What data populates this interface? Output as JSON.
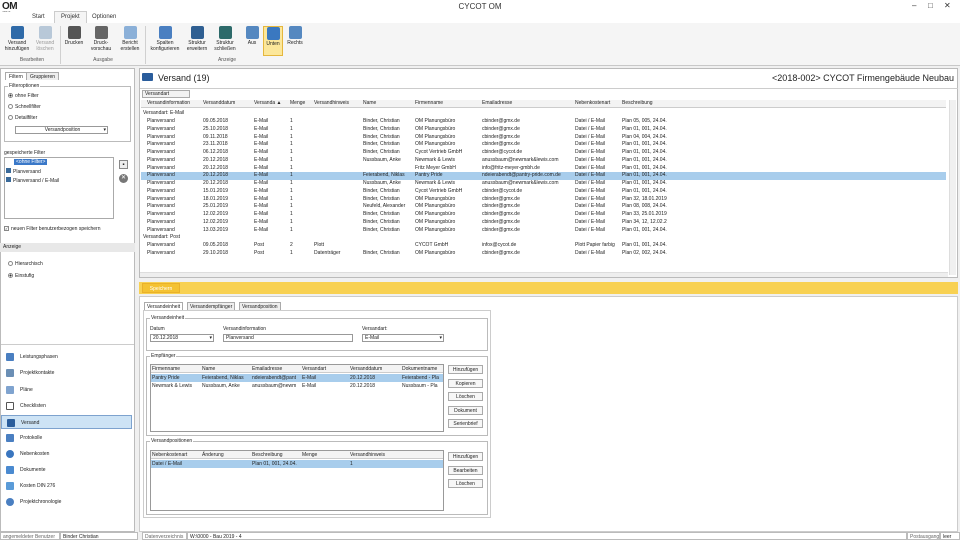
{
  "app": {
    "title": "CYCOT OM",
    "logo": "OM",
    "logo_sub": "gebäude"
  },
  "window_controls": [
    "–",
    "□",
    "✕"
  ],
  "ribbon_tabs": [
    "Start",
    "Projekt",
    "Optionen"
  ],
  "ribbon": {
    "buttons": [
      {
        "label": "Versand hinzufügen",
        "icon": "add-mail-icon",
        "disabled": false
      },
      {
        "label": "Versand löschen",
        "icon": "delete-mail-icon",
        "disabled": true
      },
      {
        "label": "Drucken",
        "icon": "printer-icon",
        "disabled": false
      },
      {
        "label": "Druck-vorschau",
        "icon": "print-preview-icon",
        "disabled": false
      },
      {
        "label": "Bericht erstellen",
        "icon": "report-icon",
        "disabled": false
      },
      {
        "label": "Spalten konfigurieren",
        "icon": "columns-icon",
        "disabled": false
      },
      {
        "label": "Struktur erweitern",
        "icon": "expand-icon",
        "disabled": false
      },
      {
        "label": "Struktur schließen",
        "icon": "collapse-icon",
        "disabled": false
      },
      {
        "label": "Aus",
        "icon": "layout-off-icon",
        "disabled": false
      },
      {
        "label": "Unten",
        "icon": "layout-bottom-icon",
        "disabled": false
      },
      {
        "label": "Rechts",
        "icon": "layout-right-icon",
        "disabled": false
      }
    ],
    "groups": [
      "Bearbeiten",
      "Ausgabe",
      "Anzeige"
    ]
  },
  "left": {
    "tabs": [
      "Filtern",
      "Gruppieren"
    ],
    "filter_options_title": "Filteroptionen",
    "filter_options": [
      "ohne Filter",
      "Schnellfilter",
      "Detailfilter"
    ],
    "filter_field": "Versandposition",
    "saved_filters_title": "gespeicherte Filter",
    "saved_filters": [
      "<ohne Filter>",
      "Planversand",
      "Planversand / E-Mail"
    ],
    "save_user_checkbox": "neuen Filter benutzerbezogen speichern",
    "display_title": "Anzeige",
    "display_options": [
      "Hierarchisch",
      "Einstufig"
    ],
    "nav": [
      "Leistungsphasen",
      "Projektkontakte",
      "Pläne",
      "Checklisten",
      "Versand",
      "Protokolle",
      "Nebenkosten",
      "Dokumente",
      "Kosten DIN 276",
      "Projektchronologie"
    ],
    "nav_active": "Versand",
    "nav_colors": [
      "#4a7fc1",
      "#6b8fb5",
      "#7fa3cf",
      "#777777",
      "#2a5d9c",
      "#4a7fc1",
      "#3a76bf",
      "#4a8ad0",
      "#5a9bd8",
      "#4a7fc1"
    ]
  },
  "main": {
    "title": "Versand (19)",
    "project": "<2018-002> CYCOT Firmengebäude Neubau",
    "group_by": "Versandart",
    "columns": [
      "Versandinformation",
      "Versanddatum",
      "Versanda ▲",
      "Menge",
      "Versandhinweis",
      "Name",
      "Firmenname",
      "Emailadresse",
      "Nebenkostenart",
      "Beschreibung"
    ],
    "group1": "Versandart: E-Mail",
    "rows": [
      [
        "Planversand",
        "09.05.2018",
        "E-Mail",
        "1",
        "",
        "Binder, Christian",
        "OM Planungsbüro",
        "cbinder@gmx.de",
        "Datei / E-Mail",
        "Plan 05, 005, 24.04."
      ],
      [
        "Planversand",
        "25.10.2018",
        "E-Mail",
        "1",
        "",
        "Binder, Christian",
        "OM Planungsbüro",
        "cbinder@gmx.de",
        "Datei / E-Mail",
        "Plan 01, 001, 24.04."
      ],
      [
        "Planversand",
        "09.11.2018",
        "E-Mail",
        "1",
        "",
        "Binder, Christian",
        "OM Planungsbüro",
        "cbinder@gmx.de",
        "Datei / E-Mail",
        "Plan 04, 004, 24.04."
      ],
      [
        "Planversand",
        "23.11.2018",
        "E-Mail",
        "1",
        "",
        "Binder, Christian",
        "OM Planungsbüro",
        "cbinder@gmx.de",
        "Datei / E-Mail",
        "Plan 01, 001, 24.04."
      ],
      [
        "Planversand",
        "06.12.2018",
        "E-Mail",
        "1",
        "",
        "Binder, Christian",
        "Cycot Vertrieb GmbH",
        "cbinder@cycot.de",
        "Datei / E-Mail",
        "Plan 01, 001, 24.04."
      ],
      [
        "Planversand",
        "20.12.2018",
        "E-Mail",
        "1",
        "",
        "Nussbaum, Anke",
        "Newmark & Lewis",
        "anussbaum@newmark&lewis.com",
        "Datei / E-Mail",
        "Plan 01, 001, 24.04."
      ],
      [
        "Planversand",
        "20.12.2018",
        "E-Mail",
        "1",
        "",
        "",
        "Fritz Meyer GmbH",
        "info@fritz-meyer-gmbh.de",
        "Datei / E-Mail",
        "Plan 01, 001, 24.04."
      ],
      [
        "Planversand",
        "20.12.2018",
        "E-Mail",
        "1",
        "",
        "Feierabend, Niklas",
        "Pantry Pride",
        "ndeierabendt@pantry-pride.com.de",
        "Datei / E-Mail",
        "Plan 01, 001, 24.04."
      ],
      [
        "Planversand",
        "20.12.2018",
        "E-Mail",
        "1",
        "",
        "Nussbaum, Anke",
        "Newmark & Lewis",
        "anussbaum@newmark&lewis.com",
        "Datei / E-Mail",
        "Plan 01, 001, 24.04."
      ],
      [
        "Planversand",
        "15.01.2019",
        "E-Mail",
        "1",
        "",
        "Binder, Christian",
        "Cycot Vertrieb GmbH",
        "cbinder@cycot.de",
        "Datei / E-Mail",
        "Plan 01, 001, 24.04."
      ],
      [
        "Planversand",
        "18.01.2019",
        "E-Mail",
        "1",
        "",
        "Binder, Christian",
        "OM Planungsbüro",
        "cbinder@gmx.de",
        "Datei / E-Mail",
        "Plan 32, 18.01.2019"
      ],
      [
        "Planversand",
        "25.01.2019",
        "E-Mail",
        "1",
        "",
        "Neufeld, Alexander",
        "OM Planungsbüro",
        "cbinder@gmx.de",
        "Datei / E-Mail",
        "Plan 08, 008, 24.04."
      ],
      [
        "Planversand",
        "12.02.2019",
        "E-Mail",
        "1",
        "",
        "Binder, Christian",
        "OM Planungsbüro",
        "cbinder@gmx.de",
        "Datei / E-Mail",
        "Plan 33, 25.01.2019"
      ],
      [
        "Planversand",
        "12.02.2019",
        "E-Mail",
        "1",
        "",
        "Binder, Christian",
        "OM Planungsbüro",
        "cbinder@gmx.de",
        "Datei / E-Mail",
        "Plan 34, 12, 12.02.2"
      ],
      [
        "Planversand",
        "13.03.2019",
        "E-Mail",
        "1",
        "",
        "Binder, Christian",
        "OM Planungsbüro",
        "cbinder@gmx.de",
        "Datei / E-Mail",
        "Plan 01, 001, 24.04."
      ]
    ],
    "selected_row": 7,
    "group2": "Versandart: Post",
    "rows2": [
      [
        "Planversand",
        "09.05.2018",
        "Post",
        "2",
        "Plott",
        "",
        "CYCOT GmbH",
        "infox@cycot.de",
        "Plott Papier farbig",
        "Plan 01, 001, 24.04."
      ],
      [
        "Planversand",
        "29.10.2018",
        "Post",
        "1",
        "Datenträger",
        "Binder, Christian",
        "OM Planungsbüro",
        "cbinder@gmx.de",
        "Datei / E-Mail",
        "Plan 02, 002, 24.04."
      ]
    ]
  },
  "save_label": "Speichern",
  "detail": {
    "tabs": [
      "Versandeinheit",
      "Versandempfänger",
      "Versandposition"
    ],
    "unit_title": "Versandeinheit",
    "date_label": "Datum",
    "date_value": "20.12.2018",
    "info_label": "Versandinformation",
    "info_value": "Planversand",
    "type_label": "Versandart:",
    "type_value": "E-Mail",
    "recipients_title": "Empfänger",
    "recipient_columns": [
      "Firmenname",
      "Name",
      "Emailadresse",
      "Versandart",
      "Versanddatum",
      "Dokumentname"
    ],
    "recipients": [
      [
        "Pantry Pride",
        "Feierabend, Niklas",
        "ndeierabendt@pant",
        "E-Mail",
        "20.12.2018",
        "Feierabend - Pla"
      ],
      [
        "Newmark & Lewis",
        "Nussbaum, Anke",
        "anussbaum@newm",
        "E-Mail",
        "20.12.2018",
        "Nussbaum - Pla"
      ]
    ],
    "recipient_buttons": [
      "Hinzufügen",
      "Kopieren",
      "Löschen",
      "Dokument",
      "Serienbrief"
    ],
    "positions_title": "Versandpositionen",
    "position_columns": [
      "Nebenkostenart",
      "Änderung",
      "Beschreibung",
      "Menge",
      "Versandhinweis"
    ],
    "positions": [
      [
        "Datei / E-Mail",
        "",
        "Plan 01, 001, 24.04.",
        "",
        "1"
      ]
    ],
    "position_buttons": [
      "Hinzufügen",
      "Bearbeiten",
      "Löschen"
    ]
  },
  "status": {
    "user_label": "angemeldeter Benutzer",
    "user": "Binder Christian",
    "dir_label": "Datenverzeichnis",
    "dir": "W:\\0000 - Bau 2019 - 4",
    "post_label": "Postausgang",
    "post": "leer"
  }
}
